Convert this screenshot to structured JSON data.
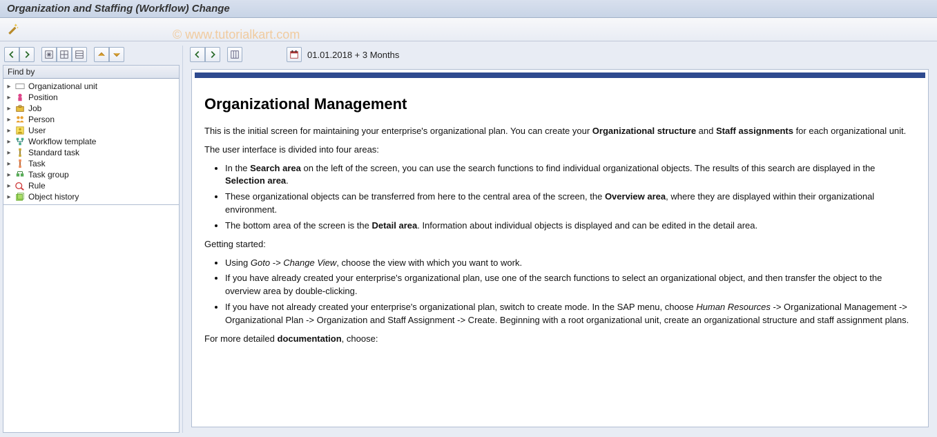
{
  "window": {
    "title": "Organization and Staffing (Workflow) Change"
  },
  "watermark": "© www.tutorialkart.com",
  "sidebar": {
    "findby_label": "Find by",
    "items": [
      {
        "label": "Organizational unit",
        "icon": "org-unit"
      },
      {
        "label": "Position",
        "icon": "position"
      },
      {
        "label": "Job",
        "icon": "job"
      },
      {
        "label": "Person",
        "icon": "person"
      },
      {
        "label": "User",
        "icon": "user"
      },
      {
        "label": "Workflow template",
        "icon": "workflow"
      },
      {
        "label": "Standard task",
        "icon": "stdtask"
      },
      {
        "label": "Task",
        "icon": "task"
      },
      {
        "label": "Task group",
        "icon": "taskgroup"
      },
      {
        "label": "Rule",
        "icon": "rule"
      },
      {
        "label": "Object history",
        "icon": "history"
      }
    ]
  },
  "right_toolbar": {
    "date_text": "01.01.2018  + 3 Months"
  },
  "document": {
    "heading": "Organizational Management",
    "intro_pre": "This is the initial screen for maintaining your enterprise's organizational plan. You can create your ",
    "intro_b1": "Organizational structure",
    "intro_mid": " and ",
    "intro_b2": "Staff assignments",
    "intro_post": " for each organizational unit.",
    "areas_intro": "The user interface is divided into four areas:",
    "area1_pre": "In the ",
    "area1_b1": "Search area",
    "area1_mid": " on the left of the screen, you can use the search functions to find individual organizational objects. The results of this search are displayed in the ",
    "area1_b2": "Selection area",
    "area1_post": ".",
    "area2_pre": "These organizational objects can be transferred from here to the central area of the screen, the ",
    "area2_b1": "Overview area",
    "area2_post": ", where they are displayed within their organizational environment.",
    "area3_pre": "The bottom area of the screen is the ",
    "area3_b1": "Detail area",
    "area3_post": ". Information about individual objects is displayed and can be edited in the detail area.",
    "getting_started": "Getting started:",
    "gs1_pre": "Using ",
    "gs1_i1": "Goto -> Change View",
    "gs1_post": ", choose the view with which you want to work.",
    "gs2": "If you have already created your enterprise's organizational plan, use one of the search functions to select an organizational object, and then transfer the object to the overview area by double-clicking.",
    "gs3_pre": "If you have not already created your enterprise's organizational plan, switch to create mode. In the SAP menu, choose ",
    "gs3_i1": "Human Resources",
    "gs3_post": " -> Organizational Management -> Organizational Plan -> Organization and Staff Assignment -> Create. Beginning with a root organizational unit, create an organizational structure and staff assignment plans.",
    "doc_line_pre": "For more detailed ",
    "doc_line_b": "documentation",
    "doc_line_post": ", choose:"
  }
}
